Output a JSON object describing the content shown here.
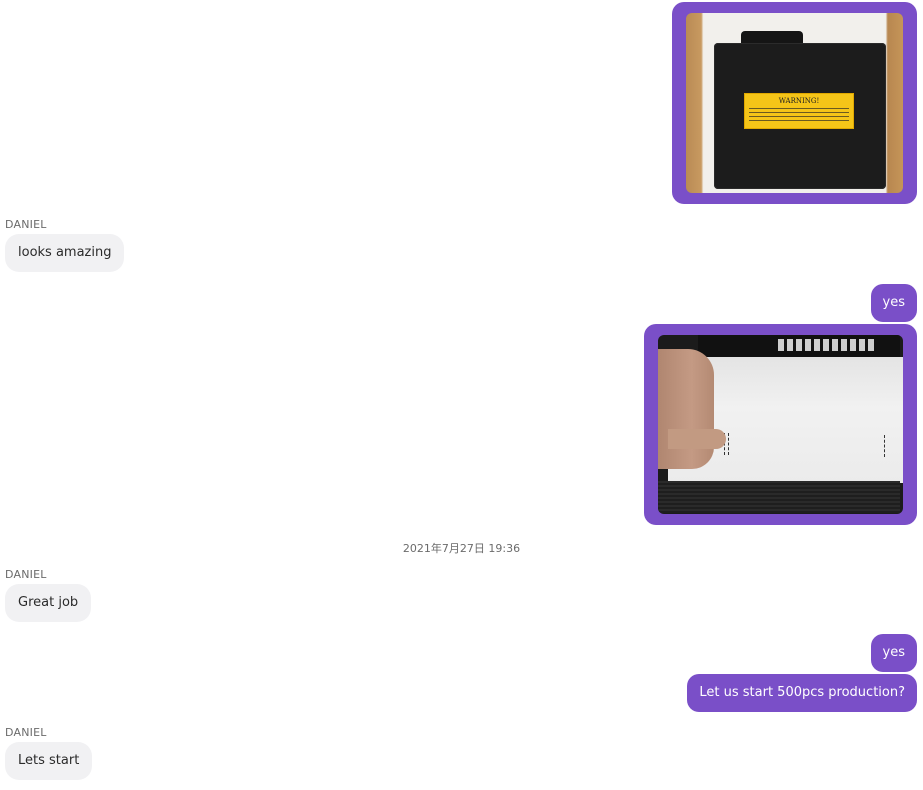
{
  "messages": [
    {
      "type": "image-out",
      "alt": "black fire-proof bag with yellow warning label",
      "label": "WARNING!"
    },
    {
      "type": "in",
      "sender": "DANIEL",
      "text": "looks amazing"
    },
    {
      "type": "out",
      "text": "yes"
    },
    {
      "type": "image-out",
      "alt": "inside of bag held open by hand"
    },
    {
      "type": "timestamp",
      "text": "2021年7月27日 19:36"
    },
    {
      "type": "in",
      "sender": "DANIEL",
      "text": "Great job"
    },
    {
      "type": "out",
      "text": "yes"
    },
    {
      "type": "out",
      "text": "Let us start 500pcs production?"
    },
    {
      "type": "in",
      "sender": "DANIEL",
      "text": "Lets start"
    }
  ],
  "colors": {
    "outgoing_bubble": "#7a4fc8",
    "incoming_bubble": "#f1f1f3"
  }
}
